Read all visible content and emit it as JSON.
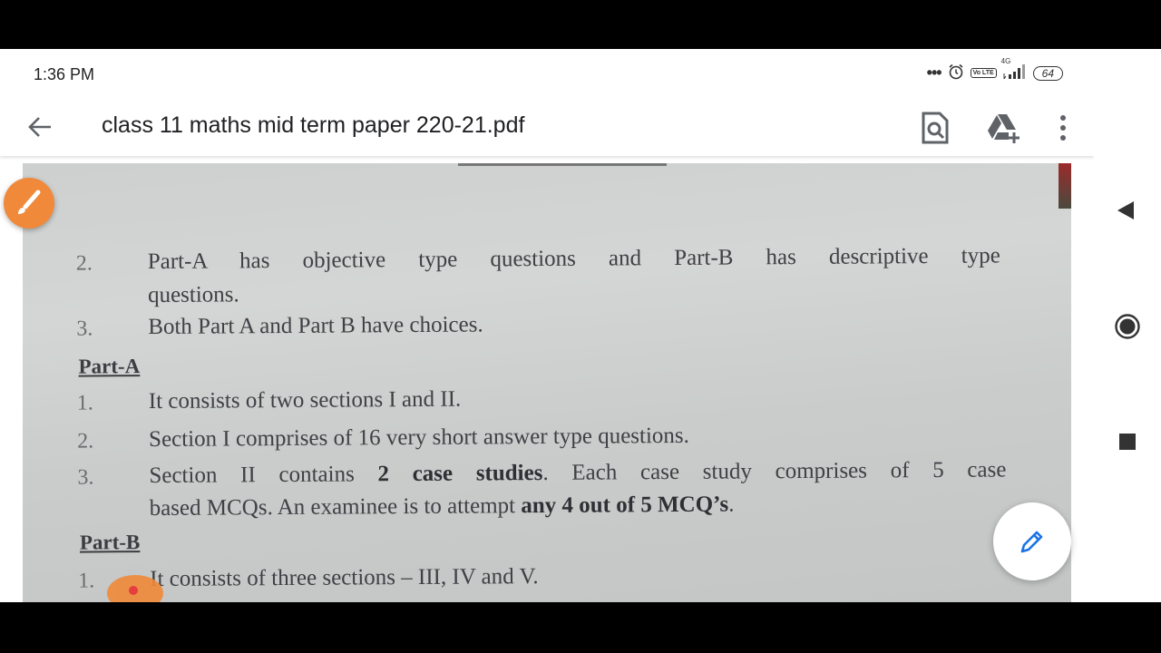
{
  "status_bar": {
    "time": "1:36 PM",
    "network": "4G",
    "volte": "Vo LTE",
    "battery": "64"
  },
  "app_bar": {
    "title": "class 11 maths mid term paper 220-21.pdf"
  },
  "document": {
    "general_instructions": [
      {
        "num": "2.",
        "text": "Part-A has objective type questions and Part-B has descriptive type",
        "text_cont": "questions."
      },
      {
        "num": "3.",
        "text": "Both Part A and Part B have choices."
      }
    ],
    "part_a": {
      "heading": "Part-A",
      "items": [
        {
          "num": "1.",
          "text": "It consists of two sections I and II."
        },
        {
          "num": "2.",
          "text": "Section I comprises of 16 very short answer type questions."
        },
        {
          "num": "3.",
          "text_a": "Section II contains ",
          "bold_a": "2 case studies",
          "text_b": ". Each case study comprises of 5 case",
          "text_c": "based MCQs. An examinee is to attempt ",
          "bold_b": "any 4 out of 5 MCQ’s",
          "text_d": "."
        }
      ]
    },
    "part_b": {
      "heading": "Part-B",
      "items": [
        {
          "num": "1.",
          "text": "It consists of three sections – III, IV and V."
        }
      ]
    }
  }
}
